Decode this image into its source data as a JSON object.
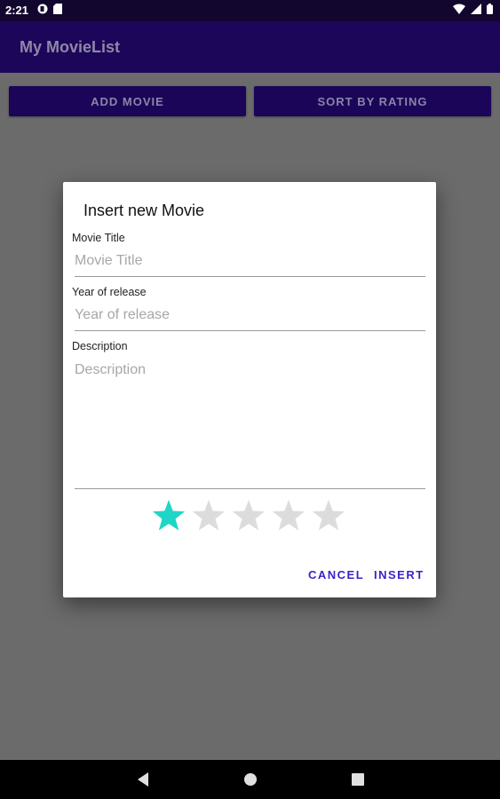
{
  "status_bar": {
    "time": "2:21",
    "icons": [
      "drive-icon",
      "sd-card-icon",
      "wifi-icon",
      "signal-icon",
      "battery-icon"
    ]
  },
  "app_bar": {
    "title": "My MovieList"
  },
  "toolbar": {
    "add_label": "ADD MOVIE",
    "sort_label": "SORT BY RATING"
  },
  "dialog": {
    "title": "Insert new Movie",
    "fields": {
      "title": {
        "label": "Movie Title",
        "placeholder": "Movie Title",
        "value": ""
      },
      "year": {
        "label": "Year of release",
        "placeholder": "Year of release",
        "value": ""
      },
      "description": {
        "label": "Description",
        "placeholder": "Description",
        "value": ""
      }
    },
    "rating": {
      "value": 1,
      "max": 5
    },
    "actions": {
      "cancel_label": "CANCEL",
      "insert_label": "INSERT"
    }
  },
  "colors": {
    "app_bar": "#1c0659",
    "status_bar": "#12062e",
    "accent": "#3f1fc6",
    "star_filled": "#1fd6c6",
    "star_empty": "#dcdcdc",
    "scrim": "#6b6b6b"
  },
  "nav_bar": {
    "icons": [
      "back-icon",
      "home-icon",
      "recents-icon"
    ]
  }
}
